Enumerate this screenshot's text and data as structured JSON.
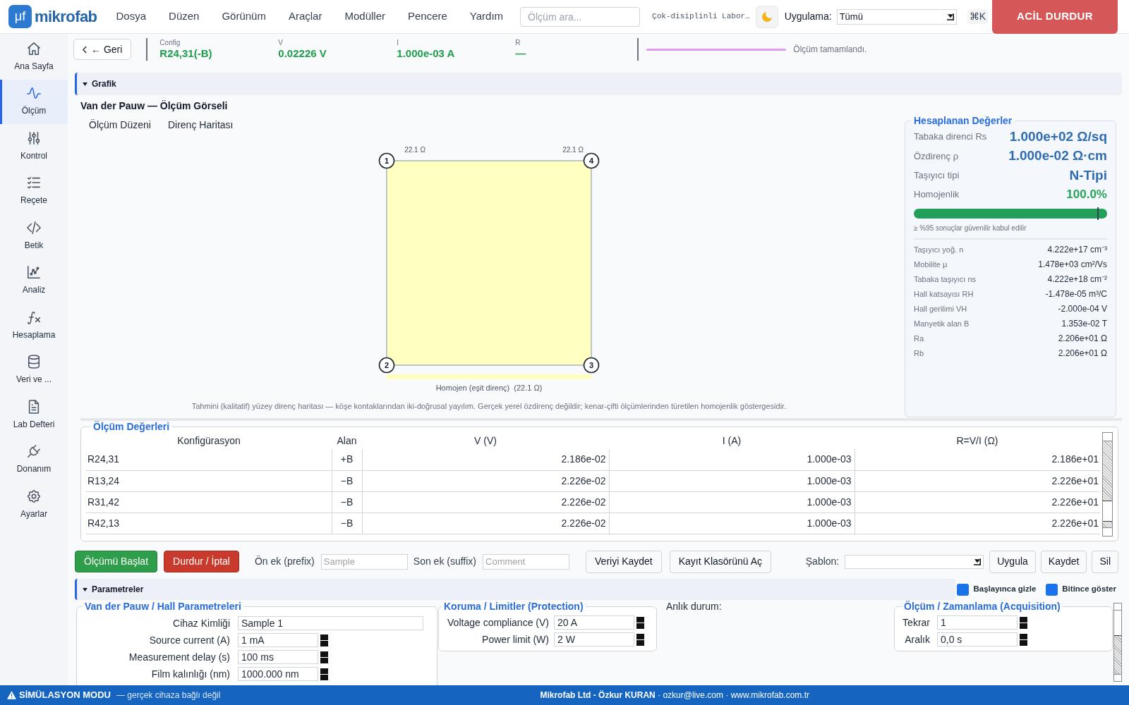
{
  "app": {
    "logo_mark": "μf",
    "name": "mikrofab"
  },
  "menu": [
    "Dosya",
    "Düzen",
    "Görünüm",
    "Araçlar",
    "Modüller",
    "Pencere",
    "Yardım"
  ],
  "search": {
    "placeholder": "Ölçüm ara..."
  },
  "lab_title": "Çok-disiplinli Labor…",
  "app_filter": {
    "label": "Uygulama:",
    "value": "Tümü"
  },
  "shortcut": "⌘K",
  "emergency_stop": "ACİL DURDUR",
  "sidebar": {
    "items": [
      {
        "label": "Ana Sayfa",
        "selected": false
      },
      {
        "label": "Ölçüm",
        "selected": true
      },
      {
        "label": "Kontrol",
        "selected": false
      },
      {
        "label": "Reçete",
        "selected": false
      },
      {
        "label": "Betik",
        "selected": false
      },
      {
        "label": "Analiz",
        "selected": false
      },
      {
        "label": "Hesaplama",
        "selected": false
      },
      {
        "label": "Veri ve ...",
        "selected": false
      },
      {
        "label": "Lab Defteri",
        "selected": false
      },
      {
        "label": "Donanım",
        "selected": false
      },
      {
        "label": "Ayarlar",
        "selected": false
      }
    ]
  },
  "toolbar": {
    "back": "← Geri",
    "readings": [
      {
        "label": "Config",
        "value": "R24,31(-B)"
      },
      {
        "label": "V",
        "value": "0.02226 V"
      },
      {
        "label": "I",
        "value": "1.000e-03 A"
      },
      {
        "label": "R",
        "value": "—"
      }
    ],
    "progress": {
      "level": 1
    },
    "message": "Ölçüm tamamlandı."
  },
  "graph_section": {
    "title": "Grafik",
    "expanded": true,
    "heading": "Van der Pauw — Ölçüm Görseli",
    "tabs": [
      {
        "label": "Ölçüm Düzeni"
      },
      {
        "label": "Direnç Haritası"
      }
    ],
    "map": {
      "contacts": [
        "1",
        "4",
        "2",
        "3"
      ],
      "edge_labels": [
        "22.1 Ω",
        "22.1 Ω"
      ],
      "legend": "Homojen (eşit direnç)  (22.1 Ω)"
    },
    "caption": "Tahmini (kalitatif) yüzey direnç haritası — köşe kontaklarından iki-doğrusal yayılım. Gerçek yerel özdirenç değildir; kenar-çifti ölçümlerinden türetilen homojenlik göstergesidir."
  },
  "results": {
    "title": "Hesaplanan Değerler",
    "primary": [
      {
        "label": "Tabaka direnci Rs",
        "value": "1.000e+02 Ω/sq"
      },
      {
        "label": "Özdirenç ρ",
        "value": "1.000e-02 Ω·cm"
      },
      {
        "label": "Taşıyıcı tipi",
        "value": "N-Tipi"
      }
    ],
    "homogeneity": {
      "label": "Homojenlik",
      "value": "100.0%",
      "level": 1
    },
    "note": "≥ %95 sonuçlar güvenilir kabul edilir",
    "details": [
      {
        "label": "Taşıyıcı yoğ. n",
        "value": "4.222e+17 cm⁻³"
      },
      {
        "label": "Mobilite μ",
        "value": "1.478e+03 cm²/Vs"
      },
      {
        "label": "Tabaka taşıyıcı ns",
        "value": "4.222e+18 cm⁻²"
      },
      {
        "label": "Hall katsayısı RH",
        "value": "-1.478e-05 m³/C"
      },
      {
        "label": "Hall gerilimi VH",
        "value": "-2.000e-04 V"
      },
      {
        "label": "Manyetik alan B",
        "value": "1.353e-02 T"
      },
      {
        "label": "Ra",
        "value": "2.206e+01 Ω"
      },
      {
        "label": "Rb",
        "value": "2.206e+01 Ω"
      }
    ]
  },
  "measurements": {
    "title": "Ölçüm Değerleri",
    "columns": [
      "Konfigürasyon",
      "Alan",
      "V (V)",
      "I (A)",
      "R=V/I (Ω)"
    ],
    "rows": [
      [
        "R24,31",
        "+B",
        "2.186e-02",
        "1.000e-03",
        "2.186e+01"
      ],
      [
        "R13,24",
        "−B",
        "2.226e-02",
        "1.000e-03",
        "2.226e+01"
      ],
      [
        "R31,42",
        "−B",
        "2.226e-02",
        "1.000e-03",
        "2.226e+01"
      ],
      [
        "R42,13",
        "−B",
        "2.226e-02",
        "1.000e-03",
        "2.226e+01"
      ]
    ]
  },
  "actions": {
    "start": "Ölçümü Başlat",
    "stop": "Durdur / İptal",
    "prefix": {
      "label": "Ön ek (prefix)",
      "placeholder": "Sample"
    },
    "suffix": {
      "label": "Son ek (suffix)",
      "placeholder": "Comment"
    },
    "save_data": "Veriyi Kaydet",
    "open_folder": "Kayıt Klasörünü Aç",
    "template": {
      "label": "Şablon:"
    },
    "template_buttons": [
      "Uygula",
      "Kaydet",
      "Sil"
    ]
  },
  "parameters": {
    "title": "Parametreler",
    "expanded": true,
    "options": [
      {
        "label": "Başlayınca gizle",
        "checked": true
      },
      {
        "label": "Bitince göster",
        "checked": true
      }
    ],
    "groups": [
      {
        "title": "Van der Pauw / Hall Parametreleri",
        "fields": [
          {
            "label": "Cihaz Kimliği",
            "value": "Sample 1",
            "kind": "text"
          },
          {
            "label": "Source current (A)",
            "value": "1 mA",
            "kind": "spin"
          },
          {
            "label": "Measurement delay (s)",
            "value": "100 ms",
            "kind": "spin"
          },
          {
            "label": "Film kalınlığı (nm)",
            "value": "1000.000 nm",
            "kind": "spin"
          }
        ]
      },
      {
        "title": "Koruma / Limitler (Protection)",
        "fields": [
          {
            "label": "Voltage compliance (V)",
            "value": "20 A",
            "kind": "spin"
          },
          {
            "label": "Power limit (W)",
            "value": "2 W",
            "kind": "spin"
          }
        ]
      }
    ],
    "live_status": "Anlık durum:",
    "acquisition": {
      "title": "Ölçüm / Zamanlama (Acquisition)",
      "fields": [
        {
          "label": "Tekrar",
          "value": "1",
          "kind": "spin"
        },
        {
          "label": "Aralık",
          "value": "0,0 s",
          "kind": "spin"
        }
      ]
    }
  },
  "status_bar": {
    "mode": "SİMÜLASYON MODU",
    "note": "— gerçek cihaza bağlı değil",
    "credits": "**Mikrofab Ltd - Özkur KURAN** · ozkur@live.com · www.mikrofab.com.tr"
  }
}
